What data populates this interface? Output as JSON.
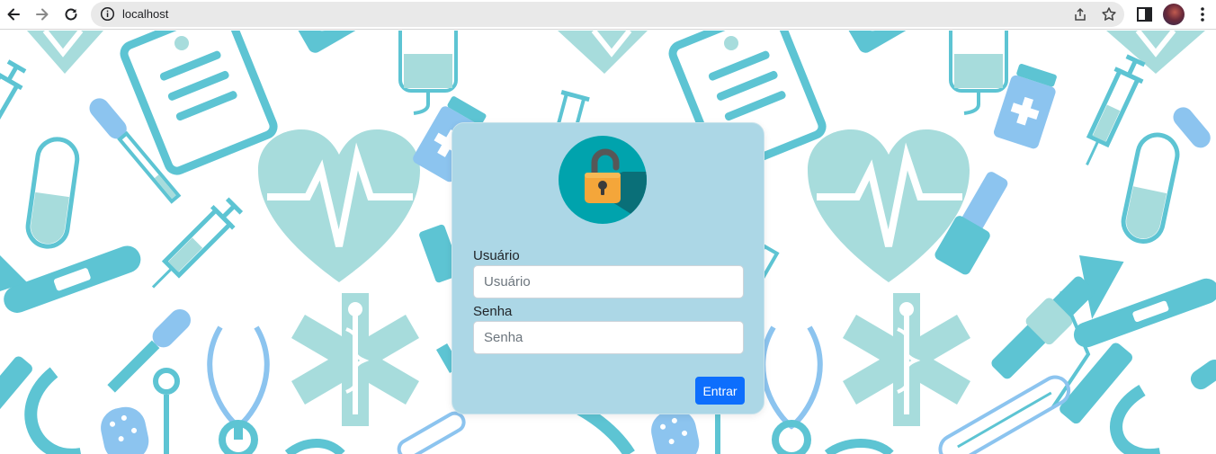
{
  "browser": {
    "url": "localhost",
    "icons": [
      "back-icon",
      "forward-icon",
      "reload-icon",
      "info-icon",
      "share-icon",
      "bookmark-star-icon",
      "side-panel-icon",
      "avatar",
      "menu-kebab-icon"
    ]
  },
  "login": {
    "lock_icon": "unlocked-padlock-icon",
    "user_label": "Usuário",
    "user_placeholder": "Usuário",
    "password_label": "Senha",
    "password_placeholder": "Senha",
    "submit_label": "Entrar"
  },
  "colors": {
    "card_bg": "#acd7e6",
    "button": "#0d6efd",
    "pattern_teal": "#5dc4d3",
    "pattern_mint": "#a7dcdc",
    "pattern_blue": "#8cc4ef"
  },
  "background": {
    "theme": "medical-icons-pattern"
  }
}
